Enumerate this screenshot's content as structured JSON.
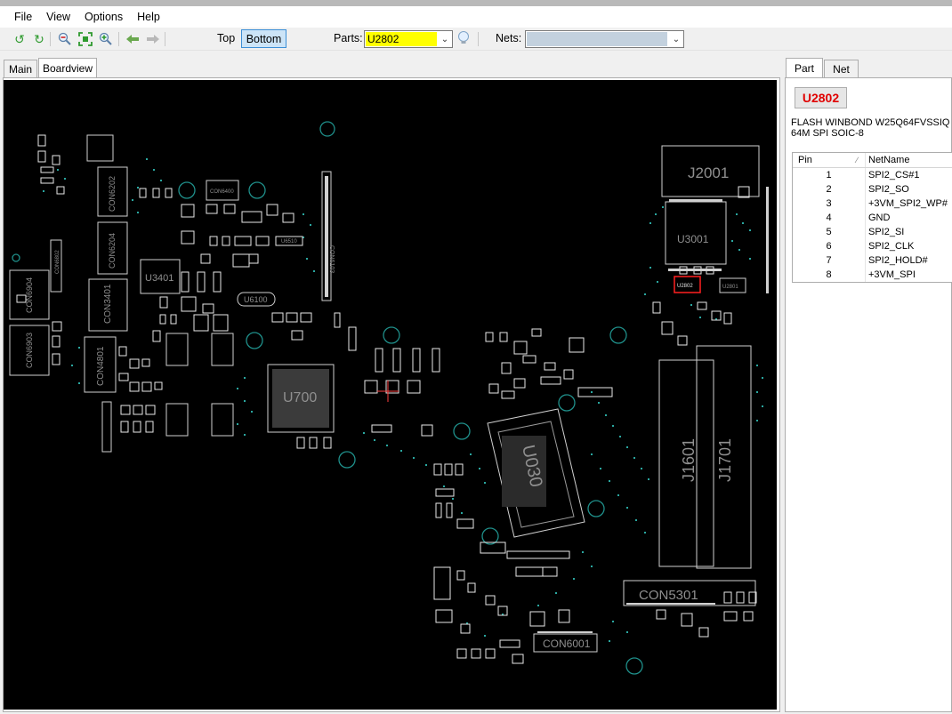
{
  "menu": [
    "File",
    "View",
    "Options",
    "Help"
  ],
  "toolbar": {
    "icons": [
      "rotate-left-icon",
      "rotate-right-icon",
      "zoom-out-icon",
      "zoom-fit-icon",
      "zoom-in-icon",
      "back-arrow-icon",
      "forward-arrow-icon"
    ],
    "top_label": "Top",
    "bottom_label": "Bottom",
    "parts_label": "Parts:",
    "parts_value": "U2802",
    "nets_label": "Nets:",
    "nets_value": ""
  },
  "left_tabs": [
    "Main",
    "Boardview"
  ],
  "right_tabs": [
    "Part",
    "Net"
  ],
  "part": {
    "name": "U2802",
    "description_line1": "FLASH WINBOND W25Q64FVSSIQ",
    "description_line2": "64M SPI SOIC-8"
  },
  "pin_table": {
    "headers": [
      "Pin",
      "NetName"
    ],
    "rows": [
      {
        "pin": "1",
        "net": "SPI2_CS#1"
      },
      {
        "pin": "2",
        "net": "SPI2_SO"
      },
      {
        "pin": "3",
        "net": "+3VM_SPI2_WP#"
      },
      {
        "pin": "4",
        "net": "GND"
      },
      {
        "pin": "5",
        "net": "SPI2_SI"
      },
      {
        "pin": "6",
        "net": "SPI2_CLK"
      },
      {
        "pin": "7",
        "net": "SPI2_HOLD#"
      },
      {
        "pin": "8",
        "net": "+3VM_SPI"
      }
    ]
  },
  "board_labels": {
    "j2001": "J2001",
    "u3001": "U3001",
    "u2802": "U2802",
    "u2801": "U2801",
    "u3401": "U3401",
    "u7000": "U700",
    "u0301": "U030",
    "j1601": "J1601",
    "j1701": "J1701",
    "con5301": "CON5301",
    "con6001": "CON6001",
    "con6904": "CON6904",
    "con6903": "CON6903",
    "con6202": "CON6202",
    "con6204": "CON6204",
    "con3401": "CON3401",
    "con4801": "CON4801",
    "con6103": "CON6103",
    "con6802": "CON6802",
    "u6100": "U6100",
    "con6400": "CON6400",
    "u6510": "U6510"
  },
  "colors": {
    "board_bg": "#000000",
    "outline": "#cfcfcf",
    "label": "#8f8f8f",
    "pad_teal": "#2aa7a0",
    "pad_white": "#e8e8e8",
    "highlight": "#ff2020",
    "parts_field": "#ffff00",
    "nets_field": "#c3d1de"
  }
}
